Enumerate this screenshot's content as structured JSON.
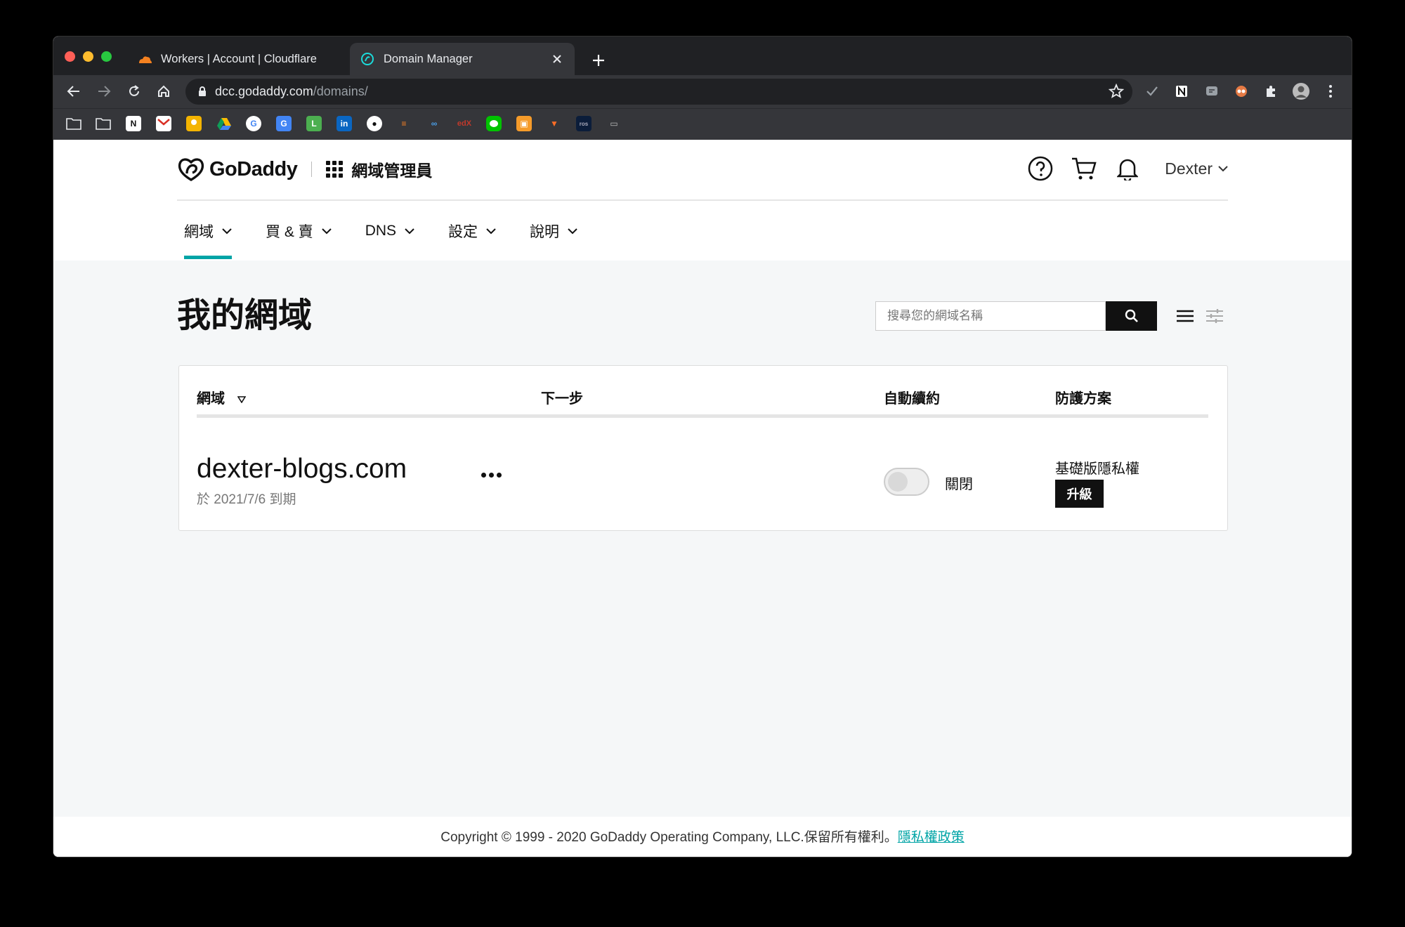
{
  "browser": {
    "tabs": [
      {
        "title": "Workers | Account | Cloudflare",
        "icon": "cloudflare-icon"
      },
      {
        "title": "Domain Manager",
        "icon": "godaddy-icon",
        "active": true
      }
    ],
    "url_host": "dcc.godaddy.com",
    "url_path": "/domains/"
  },
  "header": {
    "brand": "GoDaddy",
    "app_title": "網域管理員",
    "user": "Dexter"
  },
  "nav": {
    "items": [
      {
        "label": "網域",
        "active": true
      },
      {
        "label": "買 & 賣"
      },
      {
        "label": "DNS"
      },
      {
        "label": "設定"
      },
      {
        "label": "說明"
      }
    ]
  },
  "main": {
    "title": "我的網域",
    "search_placeholder": "搜尋您的網域名稱",
    "columns": [
      "網域",
      "下一步",
      "自動續約",
      "防護方案"
    ],
    "rows": [
      {
        "domain": "dexter-blogs.com",
        "expiry": "於 2021/7/6 到期",
        "auto_renew": "關閉",
        "plan": "基礎版隱私權",
        "plan_action": "升級"
      }
    ]
  },
  "footer": {
    "copyright": "Copyright © 1999 - 2020 GoDaddy Operating Company, LLC.保留所有權利。",
    "privacy_link": "隱私權政策"
  },
  "colors": {
    "accent": "#00a4a6",
    "dark": "#111111"
  }
}
